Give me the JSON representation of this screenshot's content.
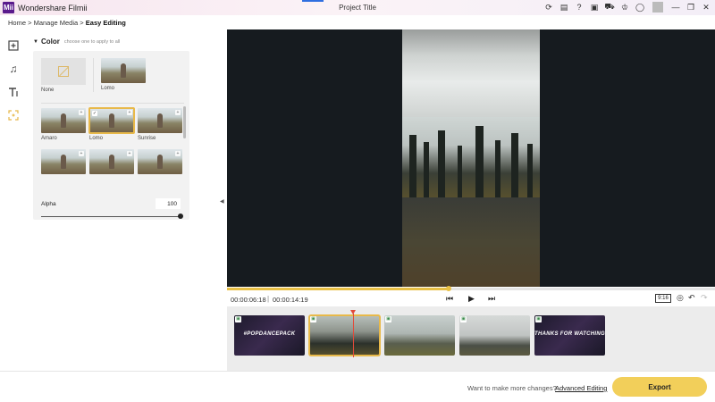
{
  "app": {
    "logo_text": "Mii",
    "name": "Wondershare Filmii",
    "project_title": "Project Title",
    "titlebar_icons": [
      "sync-icon",
      "notes-icon",
      "help-icon",
      "gallery-icon",
      "cart-icon",
      "premium-icon",
      "account-icon",
      "minimize-icon",
      "restore-icon",
      "close-icon"
    ]
  },
  "breadcrumb": {
    "home": "Home",
    "sep1": " > ",
    "manage": "Manage Media",
    "sep2": " > ",
    "current": "Easy Editing"
  },
  "rail": {
    "items": [
      "media-add-icon",
      "music-icon",
      "text-icon",
      "effects-icon"
    ],
    "active": "effects-icon"
  },
  "color_panel": {
    "title": "Color",
    "hint": "choose one to apply to all",
    "top_row": [
      {
        "label": "None"
      },
      {
        "label": "Lomo"
      }
    ],
    "grid": [
      {
        "label": "Amaro",
        "selected": false
      },
      {
        "label": "Lomo",
        "selected": true
      },
      {
        "label": "Sunrise",
        "selected": false
      },
      {
        "label": "",
        "selected": false
      },
      {
        "label": "",
        "selected": false
      },
      {
        "label": "",
        "selected": false
      }
    ],
    "alpha_label": "Alpha",
    "alpha_value": "100",
    "alpha_fraction": 1.0
  },
  "playback": {
    "current_time": "00:00:06:18",
    "separator": "|",
    "total_time": "00:00:14:19",
    "progress_fraction": 0.455,
    "aspect_ratio": "9:16"
  },
  "timeline": {
    "clips": [
      {
        "type": "dark",
        "text": "#POPDANCEPACK",
        "selected": false
      },
      {
        "type": "forest1",
        "text": "",
        "selected": true
      },
      {
        "type": "forest2",
        "text": "",
        "selected": false
      },
      {
        "type": "forest3",
        "text": "",
        "selected": false
      },
      {
        "type": "dark",
        "text": "THANKS FOR WATCHING",
        "selected": false
      }
    ]
  },
  "footer": {
    "question": "Want to make more changes?",
    "link": "Advanced Editing",
    "export": "Export"
  },
  "colors": {
    "accent": "#f2cf5a",
    "selection": "#e8b94a",
    "playhead": "#e24a3a",
    "preview_bg": "#161b1f"
  }
}
